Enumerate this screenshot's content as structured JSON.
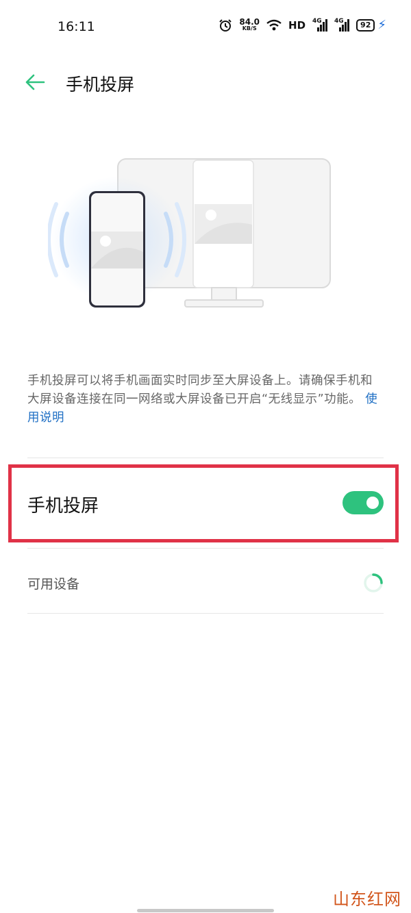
{
  "status_bar": {
    "time": "16:11",
    "net_speed": "84.0",
    "net_speed_unit": "KB/S",
    "hd_label": "HD",
    "network_1": "4G",
    "network_2": "4G",
    "battery": "92"
  },
  "header": {
    "title": "手机投屏",
    "back_icon": "arrow-left-icon"
  },
  "illustration": {
    "icon": "phone-to-monitor-cast-illustration"
  },
  "description": {
    "text": "手机投屏可以将手机画面实时同步至大屏设备上。请确保手机和大屏设备连接在同一网络或大屏设备已开启“无线显示”功能。",
    "link_text": "使用说明"
  },
  "cast_toggle": {
    "label": "手机投屏",
    "enabled": true
  },
  "available_devices": {
    "label": "可用设备",
    "loading_icon": "spinner-icon"
  },
  "watermark": {
    "text": "山东红网"
  },
  "colors": {
    "accent": "#2ec27e",
    "link": "#1f6fc4",
    "highlight": "#e03247"
  }
}
